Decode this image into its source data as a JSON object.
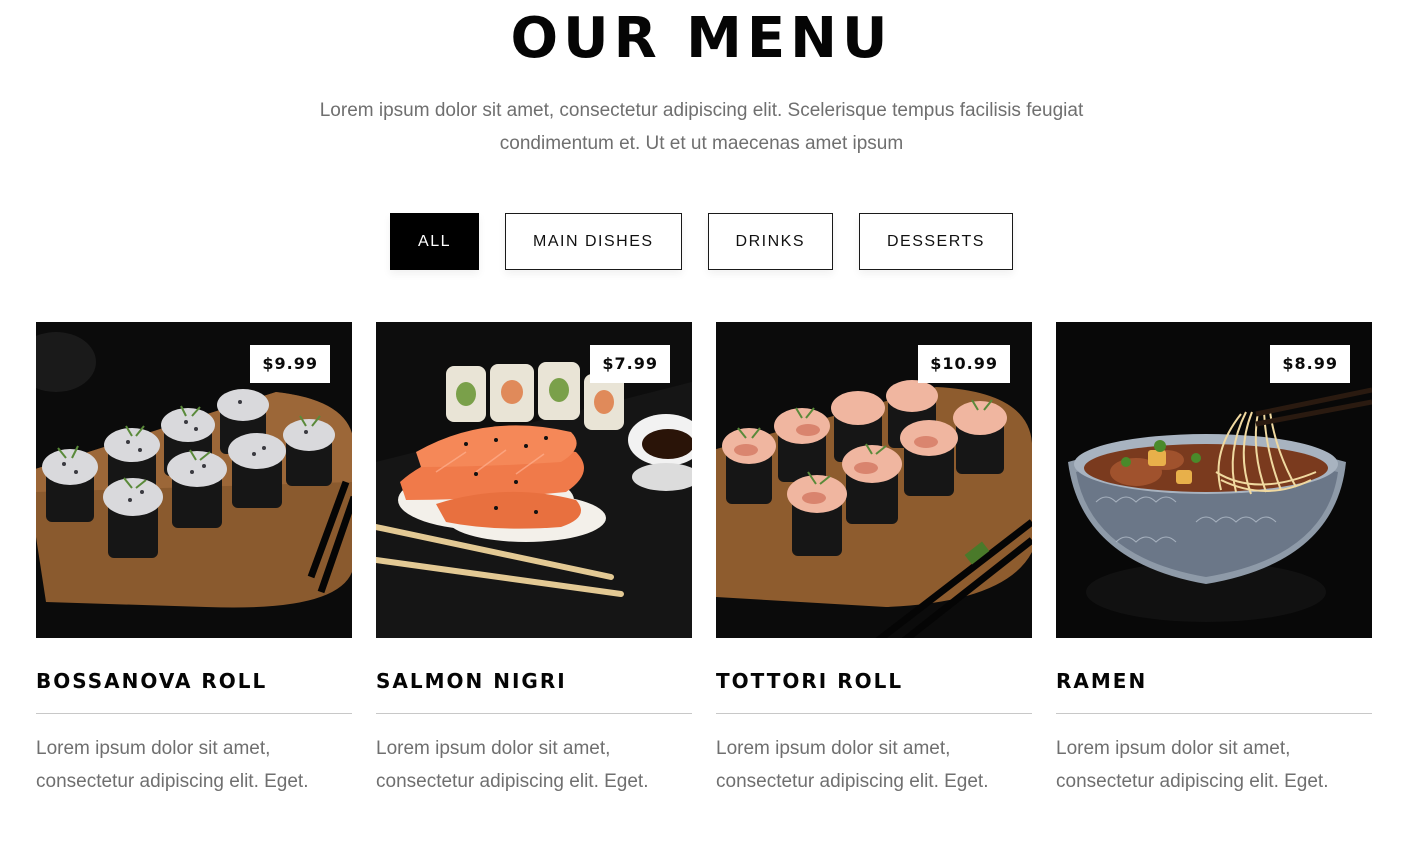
{
  "header": {
    "title": "OUR MENU",
    "subtitle_line1": "Lorem ipsum dolor sit amet, consectetur adipiscing elit. Scelerisque tempus facilisis feugiat",
    "subtitle_line2": "condimentum et. Ut et ut maecenas amet ipsum"
  },
  "filters": [
    {
      "label": "ALL",
      "active": true
    },
    {
      "label": "MAIN DISHES",
      "active": false
    },
    {
      "label": "DRINKS",
      "active": false
    },
    {
      "label": "DESSERTS",
      "active": false
    }
  ],
  "items": [
    {
      "name": "BOSSANOVA ROLL",
      "price": "$9.99",
      "desc_line1": "Lorem ipsum dolor sit amet,",
      "desc_line2": "consectetur adipiscing elit. Eget."
    },
    {
      "name": "SALMON NIGRI",
      "price": "$7.99",
      "desc_line1": "Lorem ipsum dolor sit amet,",
      "desc_line2": "consectetur adipiscing elit. Eget."
    },
    {
      "name": "TOTTORI ROLL",
      "price": "$10.99",
      "desc_line1": "Lorem ipsum dolor sit amet,",
      "desc_line2": "consectetur adipiscing elit. Eget."
    },
    {
      "name": "RAMEN",
      "price": "$8.99",
      "desc_line1": "Lorem ipsum dolor sit amet,",
      "desc_line2": "consectetur adipiscing elit. Eget."
    }
  ],
  "colors": {
    "text": "#050505",
    "muted": "#6f6f6f",
    "active_tab_bg": "#000000",
    "photo_bg": "#0c0c0c"
  }
}
